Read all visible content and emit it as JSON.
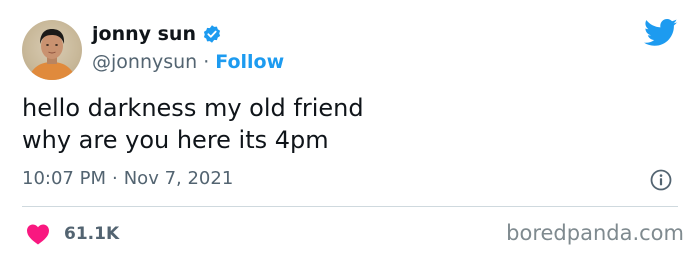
{
  "tweet": {
    "display_name": "jonny sun",
    "handle": "@jonnysun",
    "separator": "·",
    "follow_label": "Follow",
    "text": "hello darkness my old friend\nwhy are you here its 4pm",
    "time": "10:07 PM",
    "date": "Nov 7, 2021",
    "likes": "61.1K"
  },
  "icons": {
    "verified": "verified-badge-icon",
    "platform": "twitter-bird-icon",
    "info": "info-icon",
    "like": "heart-icon"
  },
  "colors": {
    "accent": "#1d9bf0",
    "like": "#f91880",
    "muted_text": "#536471"
  },
  "watermark": "boredpanda.com"
}
